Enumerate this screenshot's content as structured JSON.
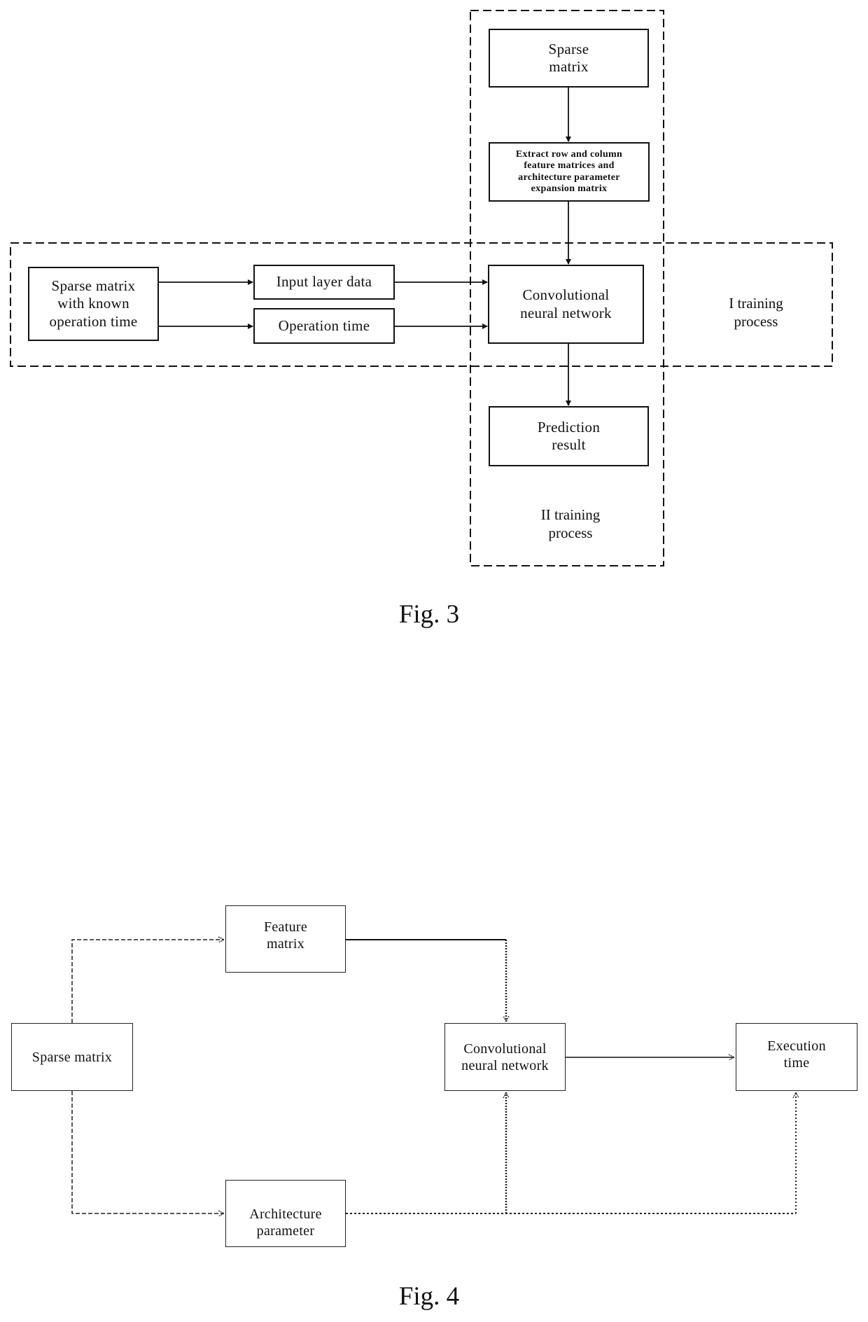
{
  "fig3": {
    "caption": "Fig. 3",
    "nodes": {
      "sparse_matrix": [
        "Sparse",
        "matrix"
      ],
      "extract": [
        "Extract row and column",
        "feature matrices and",
        "architecture parameter",
        "expansion matrix"
      ],
      "sparse_known": [
        "Sparse matrix",
        "with known",
        "operation time"
      ],
      "input_layer": [
        "Input layer data"
      ],
      "operation_time": [
        "Operation time"
      ],
      "cnn": [
        "Convolutional",
        "neural network"
      ],
      "prediction": [
        "Prediction",
        "result"
      ]
    },
    "regions": {
      "training_1": [
        "I training",
        "process"
      ],
      "training_2": [
        "II training",
        "process"
      ]
    }
  },
  "fig4": {
    "caption": "Fig. 4",
    "nodes": {
      "sparse_matrix": [
        "Sparse matrix"
      ],
      "feature_matrix": [
        "Feature",
        "matrix"
      ],
      "cnn": [
        "Convolutional",
        "neural network"
      ],
      "execution_time": [
        "Execution",
        "time"
      ],
      "architecture_parameter": [
        "Architecture",
        "parameter"
      ]
    }
  }
}
